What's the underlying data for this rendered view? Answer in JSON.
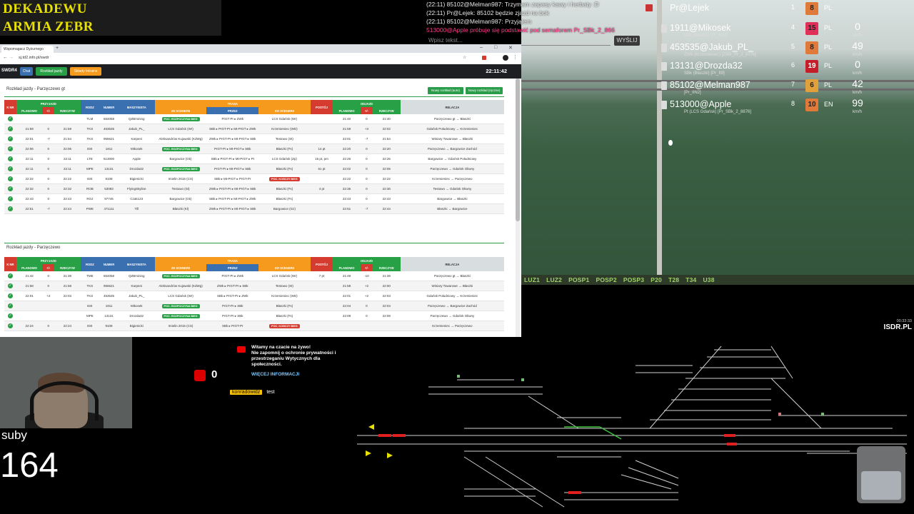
{
  "banner": {
    "line1": "DEKADEWU",
    "line2": "ARMIA ZEBR"
  },
  "chat": {
    "lines": [
      {
        "text": "(22:11) 85102@Melman987: Trzymam zapasy kawy i herbaty :D",
        "color": "normal"
      },
      {
        "text": "(22:11) Pr@Lejek: 85102 będzie zjazd na bok",
        "color": "normal"
      },
      {
        "text": "(22:11) 85102@Melman987: Przyjąłem",
        "color": "normal"
      },
      {
        "text": "513000@Apple próbuje się podstawić pod semaforem Pr_SBk_2_866",
        "color": "pink"
      }
    ],
    "input_placeholder": "Wpisz tekst...",
    "send_label": "WYŚLIJ"
  },
  "game": {
    "tabs": [
      "LUZ1",
      "LUZ2",
      "POSP1",
      "POSP2",
      "POSP3",
      "P20",
      "T28",
      "T34",
      "U38"
    ]
  },
  "players": {
    "dispatcher": "Pr@Lejek",
    "dispatcher_rank": "1",
    "dispatcher_level": "8",
    "dispatcher_country": "PL",
    "rows": [
      {
        "name": "1911@Mikosek",
        "sub": "SBk (Błaszki) [Pr_It1b]",
        "rank": "4",
        "level": "15",
        "level_color": "#e0305a",
        "country": "PL",
        "speed": "0"
      },
      {
        "name": "453535@Jakub_PL_",
        "sub": "ZWk (Krzemieniec) [ZWk_Pr_2_8776]",
        "rank": "5",
        "level": "8",
        "level_color": "#e07a3a",
        "country": "PL",
        "speed": "49"
      },
      {
        "name": "13131@Drozda32",
        "sub": "SBk (Błaszki) [Pr_It9]",
        "rank": "6",
        "level": "19",
        "level_color": "#c41e2a",
        "country": "PL",
        "speed": "0"
      },
      {
        "name": "85102@Melman987",
        "sub": "[Pr_IIN2]",
        "rank": "7",
        "level": "6",
        "level_color": "#e0a03a",
        "country": "PL",
        "speed": "42"
      },
      {
        "name": "513000@Apple",
        "sub": "Pt (LCS Gdańsk) [Pr_SBk_2_8876]",
        "rank": "8",
        "level": "10",
        "level_color": "#e07a3a",
        "country": "EN",
        "speed": "99"
      }
    ],
    "speed_unit": "km/h"
  },
  "browser": {
    "tab_title": "Wspomagacz Dyżurnego",
    "url": "sj.td2.info.pl/swdr",
    "brand": "SWDR4",
    "nav": [
      "Chat",
      "Rozkład jazdy",
      "Składy Intrains"
    ],
    "clock": "22:11:42",
    "section1": {
      "title": "Rozkład jazdy - Parzęczewo gt",
      "btn1": "Nowy rozkład (auto)",
      "btn2": "Nowy rozkład (ręczne)"
    },
    "section2": {
      "title": "Rozkład jazdy - Parzęczewo"
    },
    "headers": {
      "k": "K NR",
      "przyjazd": "PRZYJAZD",
      "planowo": "PLANOWO",
      "delay": "+/-",
      "rzeczyw": "RZECZYW",
      "rodz": "RODZ",
      "numer": "NUMER",
      "maszynista": "MASZYNISTA",
      "trasa": "TRASA",
      "ze": "ZE SCENERII",
      "przez": "PRZEZ",
      "do": "DO SCENERII",
      "postoj": "POSTÓJ",
      "odjazd": "ODJAZD",
      "relacja": "RELACJA"
    },
    "table1": [
      {
        "p": "",
        "d": "",
        "r": "",
        "rodz": "TLM",
        "num": "664058",
        "m": "QZBmining",
        "ze": "POC. ROZPOCZYNA BIEG",
        "zeType": "pill-green",
        "przez": "PrGT-Pr ▸ ZWk",
        "do": "LCS Gdańsk (Wr)",
        "post": "",
        "op": "21:40",
        "od": "0",
        "or": "21:40",
        "rel": "Parzęczewo gt → Błaszki"
      },
      {
        "p": "21:59",
        "d": "0",
        "r": "21:59",
        "rodz": "TKS",
        "num": "453535",
        "m": "Jakub_PL_",
        "ze": "LCS Gdańsk (Wr)",
        "zeType": "text",
        "przez": "SBk ▸ PrGT-Pr ▸ Mt-PrGT ▸ ZWk",
        "do": "Krzemieniec (WD)",
        "post": "",
        "op": "21:59",
        "od": "+3",
        "or": "22:02",
        "rel": "Gdańsk Południowy → Krzemieniec"
      },
      {
        "p": "22:01",
        "d": "-7",
        "r": "21:54",
        "rodz": "TKS",
        "num": "956621",
        "m": "Karpeni",
        "ze": "Aleksandrów Kujawski (KdWg)",
        "zeType": "text",
        "przez": "ZWk ▸ PrGT-Pr ▸ Mt-PrGT ▸ SBk",
        "do": "Testowo (St)",
        "post": "",
        "op": "22:01",
        "od": "-7",
        "or": "21:54",
        "rel": "Winiary Towarowe → Błaszki"
      },
      {
        "p": "22:06",
        "d": "0",
        "r": "22:06",
        "rodz": "EIE",
        "num": "1911",
        "m": "Mikosek",
        "ze": "POC. ROZPOCZYNA BIEG",
        "zeType": "pill-green",
        "przez": "PrGT-Pr ▸ Mt-PrGT ▸ SBk",
        "do": "Błaszki (Fs)",
        "post": "14 pt",
        "op": "22:20",
        "od": "0",
        "or": "22:20",
        "rel": "Parzęczewo → Bargowice Zachód"
      },
      {
        "p": "22:11",
        "d": "0",
        "r": "22:11",
        "rodz": "LTE",
        "num": "513000",
        "m": "Apple",
        "ze": "Bargowice (Gk)",
        "zeType": "text",
        "przez": "SBk ▸ PrGT-Pr ▸ Mt-PrGT ▸ Pt",
        "do": "LCS Gdańsk (Zp)",
        "post": "15 pt, pm",
        "op": "22:26",
        "od": "0",
        "or": "22:26",
        "rel": "Bargowice → Gdańsk Południowy"
      },
      {
        "p": "22:11",
        "d": "0",
        "r": "22:11",
        "rodz": "MPE",
        "num": "13131",
        "m": "Drozda32",
        "ze": "POC. ROZPOCZYNA BIEG",
        "zeType": "pill-green",
        "przez": "PrGT-Pr ▸ Mt-PrGT ▸ SBk",
        "do": "Błaszki (Fs)",
        "post": "51 pt",
        "op": "22:02",
        "od": "0",
        "or": "22:06",
        "rel": "Parzęczewo → Gdańsk Oliwny"
      },
      {
        "p": "22:22",
        "d": "0",
        "r": "22:22",
        "rodz": "EIE",
        "num": "9108",
        "m": "Bigienicki",
        "ze": "Imielin 2015 (CS)",
        "zeType": "text",
        "przez": "SBk ▸ Mt-PrGT ▸ PrGT-Pr",
        "do": "POC. KOŃCZY BIEG",
        "post": "",
        "op": "22:22",
        "od": "0",
        "or": "22:22",
        "rel": "Krzemieniec → Parzęczewo"
      },
      {
        "p": "22:32",
        "d": "0",
        "r": "22:32",
        "rodz": "ROB",
        "num": "53083",
        "m": "FlyingSkyline",
        "ze": "Testowo (St)",
        "zeType": "text",
        "przez": "ZWk ▸ PrGT-Pr ▸ Mt-PrGT ▸ SBk",
        "do": "Błaszki (Fs)",
        "post": "4 pt",
        "op": "22:36",
        "od": "0",
        "or": "22:36",
        "rel": "Testowo → Gdańsk Oliwny"
      },
      {
        "p": "22:43",
        "d": "0",
        "r": "22:43",
        "rodz": "ROJ",
        "num": "97745",
        "m": "Czak123",
        "ze": "Bargowice (Gk)",
        "zeType": "text",
        "przez": "SBk ▸ PrGT-Pr ▸ Mt-PrGT ▸ ZWk",
        "do": "Błaszki (Fs)",
        "post": "",
        "op": "22:43",
        "od": "0",
        "or": "22:43",
        "rel": "Bargowice → Błaszki"
      },
      {
        "p": "22:51",
        "d": "-7",
        "r": "22:44",
        "rodz": "PWE",
        "num": "471111",
        "m": "Till",
        "ze": "Błaszki (Kl)",
        "zeType": "text",
        "przez": "ZWk ▸ PrGT-Pr ▸ Mt-PrGT ▸ SBk",
        "do": "Bargowice (Gz)",
        "post": "",
        "op": "22:51",
        "od": "-7",
        "or": "22:44",
        "rel": "Błaszki → Bargowice"
      }
    ],
    "table2": [
      {
        "p": "21:42",
        "d": "0",
        "r": "21:38",
        "rodz": "TME",
        "num": "664058",
        "m": "QZBmining",
        "ze": "POC. ROZPOCZYNA BIEG",
        "zeType": "pill-green",
        "przez": "PrGT-Pr ▸ ZWk",
        "do": "LCS Gdańsk (Wr)",
        "post": "7 pt",
        "op": "21:49",
        "od": "-10",
        "or": "21:39",
        "rel": "Parzęczewo gt → Błaszki"
      },
      {
        "p": "21:58",
        "d": "0",
        "r": "21:58",
        "rodz": "TKS",
        "num": "956621",
        "m": "Karpeni",
        "ze": "Aleksandrów Kujawski (KdWg)",
        "zeType": "text",
        "przez": "ZWk ▸ PrGT-Pr ▸ SBk",
        "do": "Testowo (St)",
        "post": "",
        "op": "21:58",
        "od": "+2",
        "or": "22:00",
        "rel": "Winiary Towarowe → Błaszki"
      },
      {
        "p": "22:01",
        "d": "+2",
        "r": "22:03",
        "rodz": "TKS",
        "num": "453535",
        "m": "Jakub_PL_",
        "ze": "LCS Gdańsk (Wr)",
        "zeType": "text",
        "przez": "SBk ▸ PrGT-Pr ▸ ZWk",
        "do": "Krzemieniec (WD)",
        "post": "",
        "op": "22:01",
        "od": "+2",
        "or": "22:03",
        "rel": "Gdańsk Południowy → Krzemieniec"
      },
      {
        "p": "",
        "d": "",
        "r": "",
        "rodz": "EIE",
        "num": "1911",
        "m": "Mikosek",
        "ze": "POC. ROZPOCZYNA BIEG",
        "zeType": "pill-green",
        "przez": "PrGT-Pr ▸ SBk",
        "do": "Błaszki (Fs)",
        "post": "",
        "op": "22:04",
        "od": "0",
        "or": "22:04",
        "rel": "Parzęczewo → Bargowice Zachód"
      },
      {
        "p": "",
        "d": "",
        "r": "",
        "rodz": "MPE",
        "num": "13131",
        "m": "Drozda32",
        "ze": "POC. ROZPOCZYNA BIEG",
        "zeType": "pill-green",
        "przez": "PrGT-Pr ▸ SBk",
        "do": "Błaszki (Fs)",
        "post": "",
        "op": "22:09",
        "od": "0",
        "or": "22:09",
        "rel": "Parzęczewo → Gdańsk Oliwny"
      },
      {
        "p": "22:24",
        "d": "0",
        "r": "22:24",
        "rodz": "EIE",
        "num": "9108",
        "m": "Bigienicki",
        "ze": "Imielin 2015 (CS)",
        "zeType": "text",
        "przez": "SBk ▸ PrGT-Pr",
        "do": "POC. KOŃCZY BIEG",
        "post": "",
        "op": "",
        "od": "",
        "or": "",
        "rel": "Krzemieniec → Parzęczewo"
      }
    ]
  },
  "stream": {
    "subs_label": "suby",
    "subs_count": "164",
    "yt_note_line1": "Witamy na czacie na żywo!",
    "yt_note_line2": "Nie zapomnij o ochronie prywatności i przestrzeganiu Wytycznych dla społeczności.",
    "yt_more": "WIĘCEJ INFORMACJI",
    "yt_viewers": "0",
    "yt_user": "konradowidz",
    "yt_message": "test",
    "isdr_time": "00:33:33",
    "isdr_logo": "ISDR.PL"
  },
  "colors": {
    "accent_green": "#27a046",
    "accent_red": "#d63b2f",
    "accent_orange": "#f59a1c",
    "accent_blue": "#3a6fb0"
  }
}
